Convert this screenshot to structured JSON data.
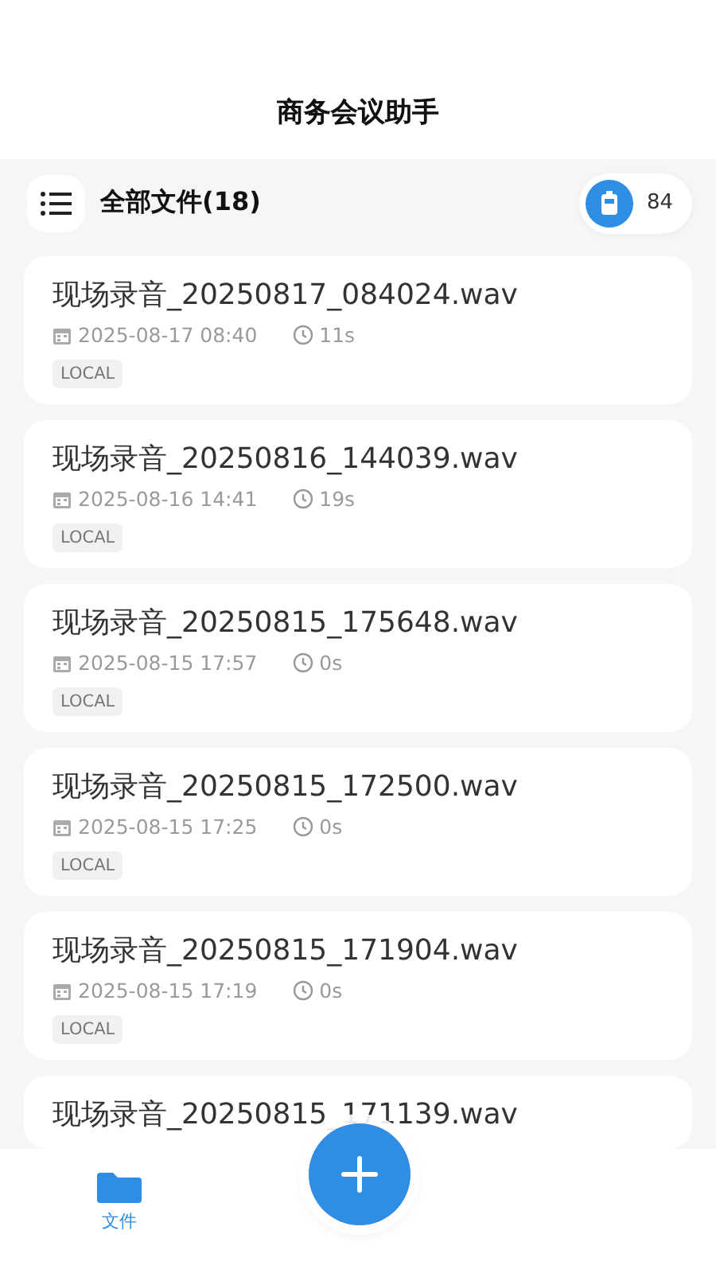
{
  "header": {
    "title": "商务会议助手"
  },
  "toolbar": {
    "title": "全部文件(18)",
    "storage_count": "84"
  },
  "files": [
    {
      "name": "现场录音_20250817_084024.wav",
      "date": "2025-08-17 08:40",
      "duration": "11s",
      "tag": "LOCAL"
    },
    {
      "name": "现场录音_20250816_144039.wav",
      "date": "2025-08-16 14:41",
      "duration": "19s",
      "tag": "LOCAL"
    },
    {
      "name": "现场录音_20250815_175648.wav",
      "date": "2025-08-15 17:57",
      "duration": "0s",
      "tag": "LOCAL"
    },
    {
      "name": "现场录音_20250815_172500.wav",
      "date": "2025-08-15 17:25",
      "duration": "0s",
      "tag": "LOCAL"
    },
    {
      "name": "现场录音_20250815_171904.wav",
      "date": "2025-08-15 17:19",
      "duration": "0s",
      "tag": "LOCAL"
    },
    {
      "name": "现场录音_20250815_171139.wav"
    }
  ],
  "nav": [
    {
      "label": "文件",
      "selected": true
    }
  ]
}
